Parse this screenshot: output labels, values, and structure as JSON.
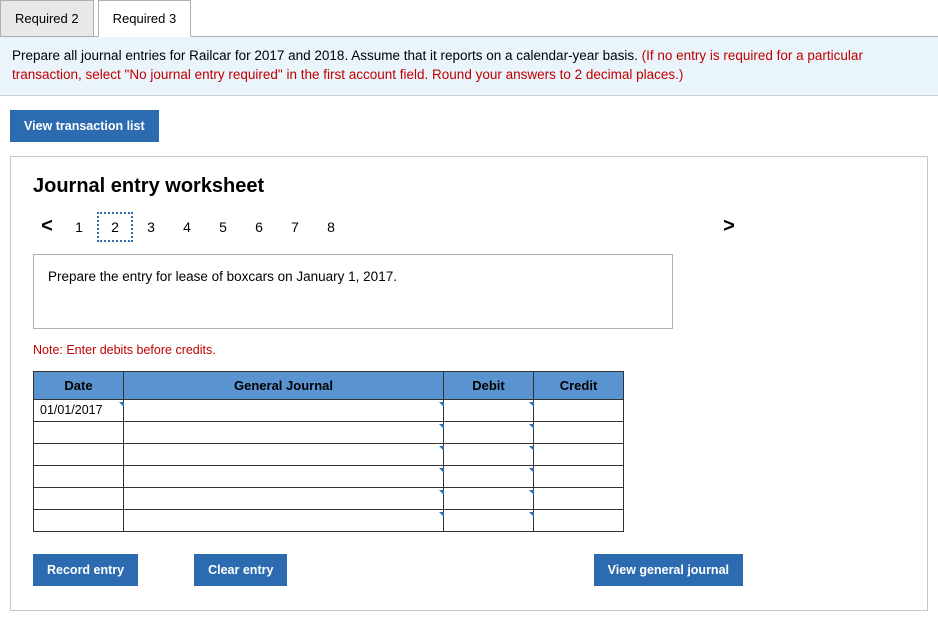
{
  "tabs": [
    {
      "label": "Required 2",
      "active": false
    },
    {
      "label": "Required 3",
      "active": true
    }
  ],
  "instruction": {
    "main": "Prepare all journal entries for Railcar for 2017 and 2018. Assume that it reports on a calendar-year basis. ",
    "addendum": "(If no entry is required for a particular transaction, select \"No journal entry required\" in the first account field. Round your answers to 2 decimal places.)"
  },
  "buttons": {
    "view_transaction_list": "View transaction list",
    "record_entry": "Record entry",
    "clear_entry": "Clear entry",
    "view_general_journal": "View general journal"
  },
  "worksheet": {
    "title": "Journal entry worksheet",
    "pager": {
      "prev": "<",
      "next": ">",
      "pages": [
        "1",
        "2",
        "3",
        "4",
        "5",
        "6",
        "7",
        "8"
      ],
      "current": "2"
    },
    "entry_description": "Prepare the entry for lease of boxcars on January 1, 2017.",
    "note": "Note: Enter debits before credits.",
    "table": {
      "headers": {
        "date": "Date",
        "gj": "General Journal",
        "debit": "Debit",
        "credit": "Credit"
      },
      "rows": [
        {
          "date": "01/01/2017",
          "gj": "",
          "debit": "",
          "credit": ""
        },
        {
          "date": "",
          "gj": "",
          "debit": "",
          "credit": ""
        },
        {
          "date": "",
          "gj": "",
          "debit": "",
          "credit": ""
        },
        {
          "date": "",
          "gj": "",
          "debit": "",
          "credit": ""
        },
        {
          "date": "",
          "gj": "",
          "debit": "",
          "credit": ""
        },
        {
          "date": "",
          "gj": "",
          "debit": "",
          "credit": ""
        }
      ]
    }
  }
}
